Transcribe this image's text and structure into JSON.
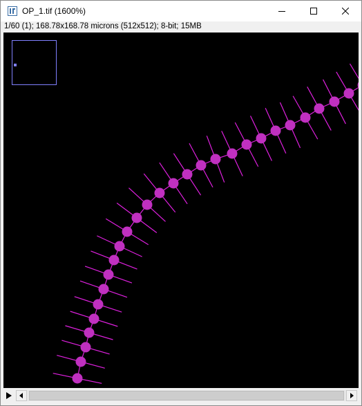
{
  "window": {
    "title": "OP_1.tif (1600%)",
    "icon": "imagej-icon",
    "controls": [
      "minimize-icon",
      "maximize-icon",
      "close-icon"
    ]
  },
  "info": {
    "text": "1/60 (1); 168.78x168.78 microns (512x512); 8-bit; 15MB"
  },
  "image": {
    "background_color": "#000000",
    "overlay_color": "#e020e0",
    "marker_color": "#c030c0",
    "navigator_color": "#8080ff"
  },
  "scrollbar": {
    "play_icon": "play-icon",
    "left_icon": "arrow-left-icon",
    "right_icon": "arrow-right-icon"
  }
}
